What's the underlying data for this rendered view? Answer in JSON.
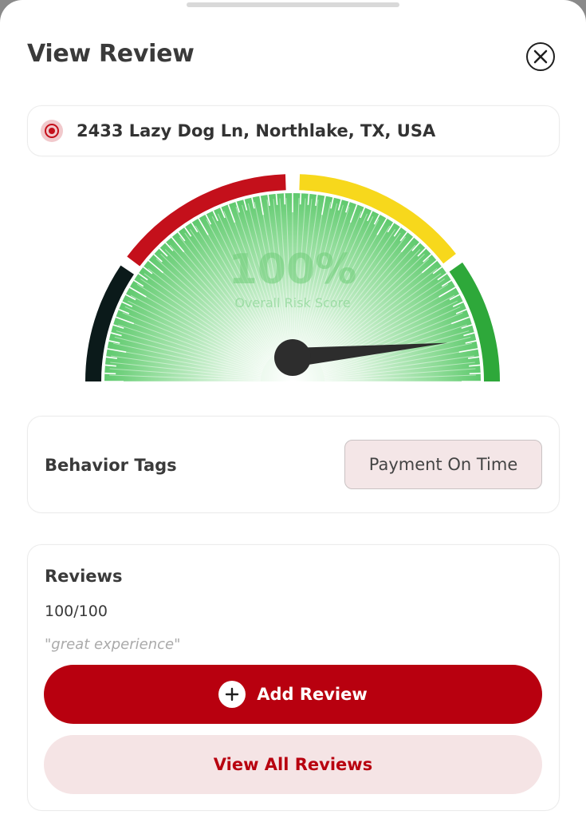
{
  "header": {
    "title": "View Review",
    "close_icon": "close-icon"
  },
  "address": {
    "text": "2433 Lazy Dog Ln, Northlake, TX, USA",
    "icon": "location-target-icon"
  },
  "gauge": {
    "score_text": "100%",
    "score_label": "Overall Risk Score",
    "needle_value": 0.97,
    "colors": {
      "black": "#0b1a1a",
      "red": "#c4101b",
      "yellow": "#f7d81c",
      "green": "#2ea83a"
    }
  },
  "behavior": {
    "label": "Behavior Tags",
    "tags": [
      "Payment On Time"
    ]
  },
  "reviews": {
    "title": "Reviews",
    "score": "100/100",
    "quote": "\"great experience\"",
    "add_button": "Add Review",
    "view_all_button": "View All Reviews"
  },
  "theme": {
    "accent": "#b8000f",
    "accent_light": "#f5e4e5"
  }
}
